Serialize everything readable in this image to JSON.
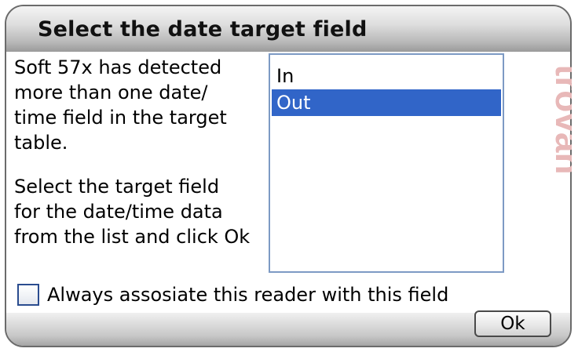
{
  "dialog": {
    "title": "Select the date target field",
    "description_lines": [
      "Soft 57x has detected",
      "more than one date/",
      "time field in the target",
      "table."
    ],
    "instruction_lines": [
      "Select the target field",
      "for the date/time data",
      "from the list and click Ok"
    ],
    "fields": [
      {
        "label": "In",
        "selected": false
      },
      {
        "label": "Out",
        "selected": true
      }
    ],
    "watermark": "trovan",
    "always_associate": {
      "label": "Always assosiate this reader with this field",
      "checked": false
    },
    "ok_label": "Ok"
  },
  "colors": {
    "selection": "#3165c8",
    "listbox_border": "#7d9ac4",
    "watermark": "#e8b8b8"
  }
}
